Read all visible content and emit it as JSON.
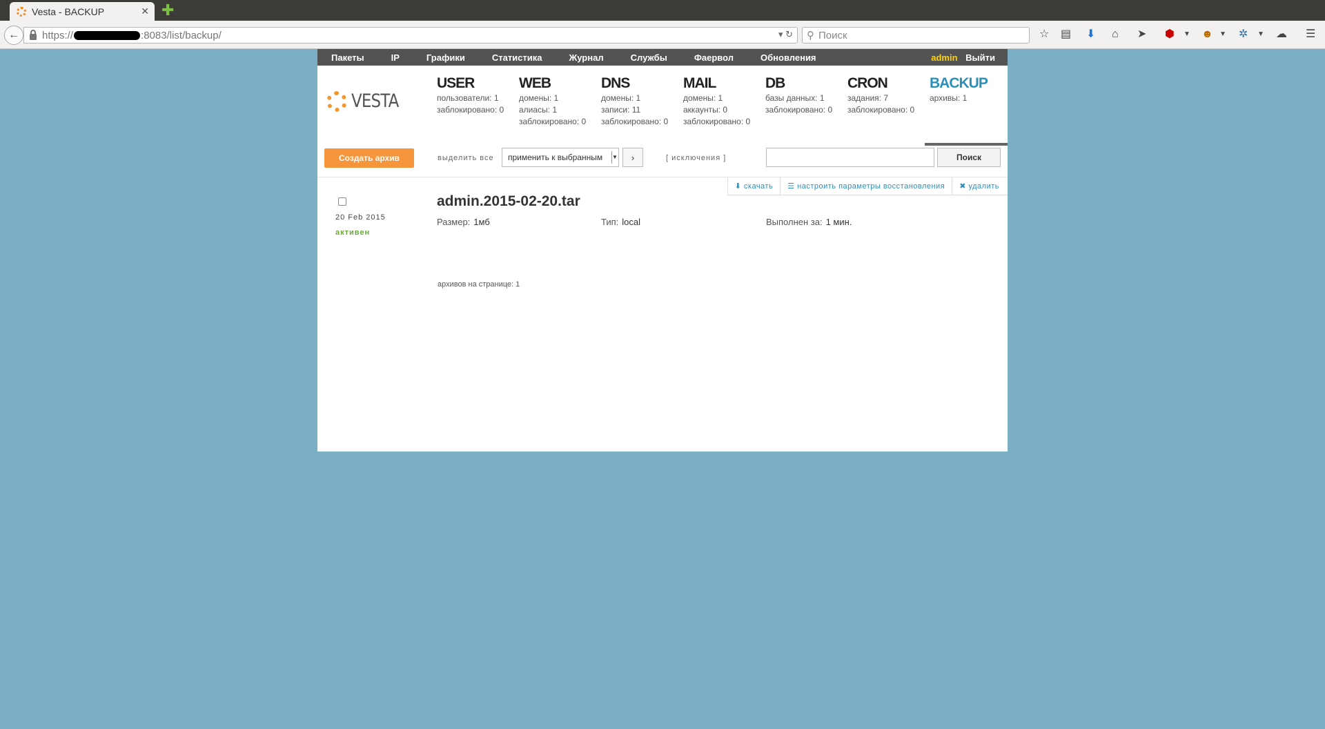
{
  "browser": {
    "tab_title": "Vesta - BACKUP",
    "url_prefix": "https://",
    "url_suffix": ":8083/list/backup/",
    "search_placeholder": "Поиск"
  },
  "topmenu": {
    "items": [
      "Пакеты",
      "IP",
      "Графики",
      "Статистика",
      "Журнал",
      "Службы",
      "Фаервол",
      "Обновления"
    ],
    "user": "admin",
    "logout": "Выйти"
  },
  "logo_text": "VESTA",
  "stats": [
    {
      "title": "USER",
      "lines": [
        "пользователи: 1",
        "заблокировано: 0"
      ]
    },
    {
      "title": "WEB",
      "lines": [
        "домены: 1",
        "алиасы: 1",
        "заблокировано: 0"
      ]
    },
    {
      "title": "DNS",
      "lines": [
        "домены: 1",
        "записи: 11",
        "заблокировано: 0"
      ]
    },
    {
      "title": "MAIL",
      "lines": [
        "домены: 1",
        "аккаунты: 0",
        "заблокировано: 0"
      ]
    },
    {
      "title": "DB",
      "lines": [
        "базы данных: 1",
        "заблокировано: 0"
      ]
    },
    {
      "title": "CRON",
      "lines": [
        "задания: 7",
        "заблокировано: 0"
      ]
    },
    {
      "title": "BACKUP",
      "lines": [
        "архивы: 1"
      ]
    }
  ],
  "toolbar": {
    "create_label": "Создать архив",
    "select_all": "выделить все",
    "apply_label": "применить к выбранным",
    "go_label": "›",
    "exclusions": "[ исключения ]",
    "search_button": "Поиск"
  },
  "backup": {
    "actions": {
      "download": "скачать",
      "restore": "настроить параметры восстановления",
      "delete": "удалить"
    },
    "date": "20 Feb 2015",
    "status": "активен",
    "name": "admin.2015-02-20.tar",
    "size_label": "Размер:",
    "size_value": "1мб",
    "type_label": "Тип:",
    "type_value": "local",
    "time_label": "Выполнен за:",
    "time_value": "1 мин."
  },
  "footer": "архивов на странице: 1",
  "colors": {
    "page_bg": "#7aafc5",
    "accent_orange": "#f5953c",
    "active_blue": "#2c8fb8",
    "admin_yellow": "#ffd200",
    "status_green": "#6aa839"
  }
}
